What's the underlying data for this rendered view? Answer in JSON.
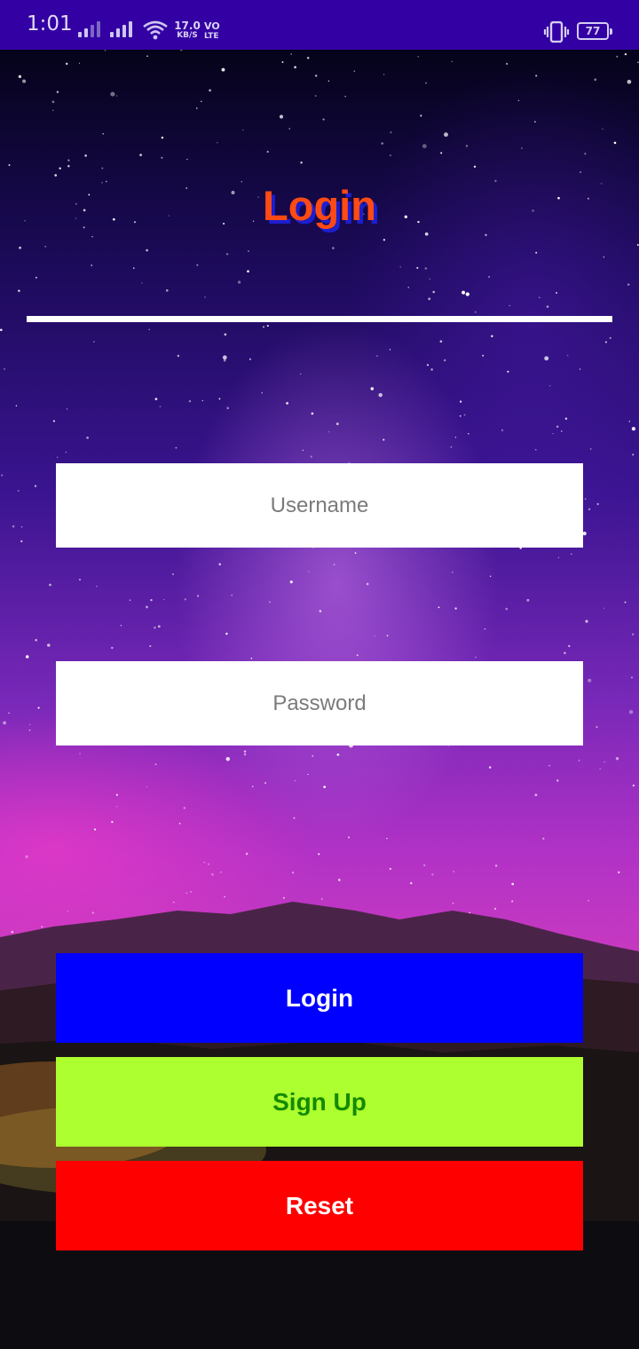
{
  "status_bar": {
    "time": "1:01",
    "net_speed_value": "17.0",
    "net_speed_unit": "KB/S",
    "volte_top": "VO",
    "volte_bottom": "LTE",
    "battery": "77",
    "color": "#3300a3",
    "icons": [
      "signal-icon",
      "signal-icon",
      "wifi-icon",
      "vibrate-icon",
      "battery-icon"
    ]
  },
  "header": {
    "title": "Login",
    "title_color": "#ff4a14",
    "title_shadow_color": "#1b1fcf"
  },
  "form": {
    "username_placeholder": "Username",
    "username_value": "",
    "password_placeholder": "Password",
    "password_value": ""
  },
  "buttons": {
    "login": {
      "label": "Login",
      "bg": "#0000ff",
      "fg": "#ffffff"
    },
    "signup": {
      "label": "Sign Up",
      "bg": "#adff2f",
      "fg": "#138a00"
    },
    "reset": {
      "label": "Reset",
      "bg": "#ff0000",
      "fg": "#ffffff"
    }
  },
  "background": {
    "description_icon": "night-sky-background"
  }
}
